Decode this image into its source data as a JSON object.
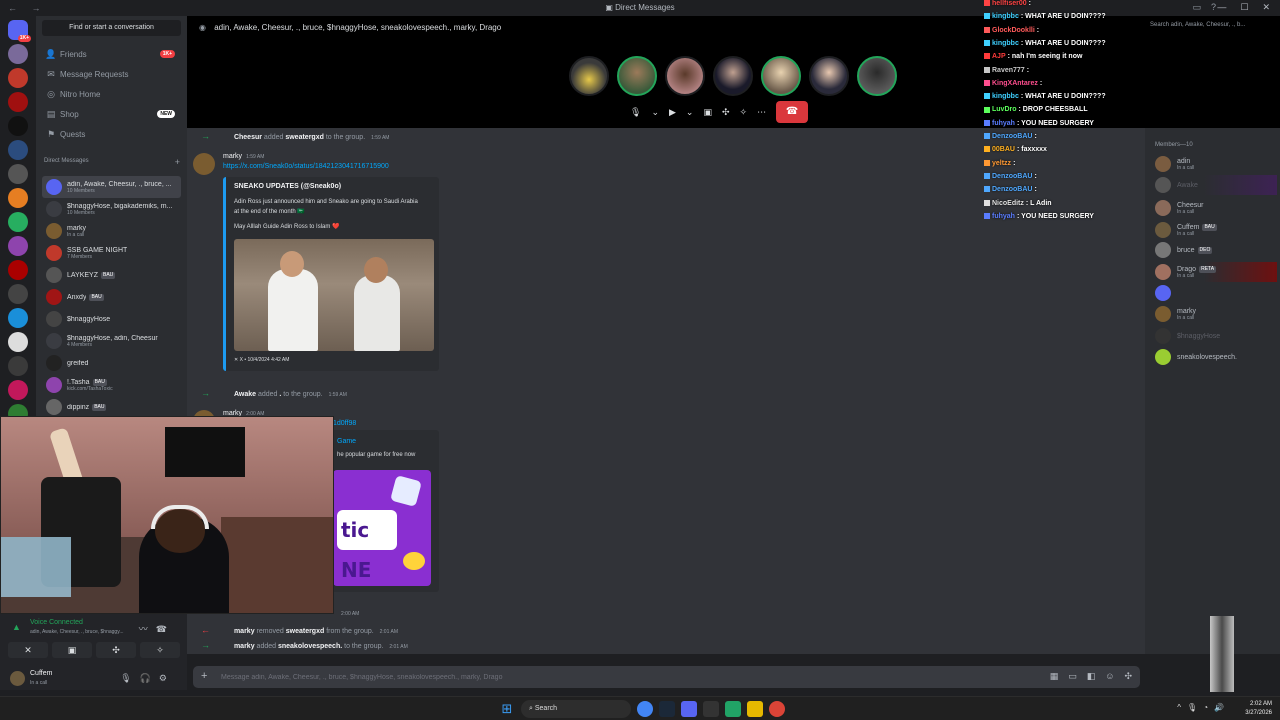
{
  "window": {
    "title": "Direct Messages"
  },
  "sidebar": {
    "find_label": "Find or start a conversation",
    "nav": [
      {
        "label": "Friends",
        "badge": "1K+"
      },
      {
        "label": "Message Requests"
      },
      {
        "label": "Nitro Home"
      },
      {
        "label": "Shop",
        "badge": "NEW"
      },
      {
        "label": "Quests"
      }
    ],
    "dm_header": "Direct Messages",
    "dms": [
      {
        "name": "adin, Awake, Cheesur, ., bruce, ...",
        "sub": "10 Members",
        "color": "#5865f2"
      },
      {
        "name": "$hnaggyHose, bigakademiks, m...",
        "sub": "10 Members",
        "color": "#3a3c42"
      },
      {
        "name": "marky",
        "sub": "In a call",
        "color": "#7a5c30"
      },
      {
        "name": "SSB GAME NIGHT",
        "sub": "7 Members",
        "color": "#c0392b"
      },
      {
        "name": "LAYKEYZ",
        "sub": "",
        "tag": "BAU",
        "color": "#555"
      },
      {
        "name": "Anxdy",
        "sub": "",
        "tag": "BAU",
        "color": "#a01515"
      },
      {
        "name": "$hnaggyHose",
        "sub": "",
        "color": "#444"
      },
      {
        "name": "$hnaggyHose, adin, Cheesur",
        "sub": "4 Members",
        "color": "#3a3c42"
      },
      {
        "name": "greifed",
        "sub": "",
        "color": "#222"
      },
      {
        "name": "!.Tasha",
        "sub": "kick.com/TashaToxic",
        "tag": "BAU",
        "color": "#8e44ad"
      },
      {
        "name": "dippinz",
        "sub": "",
        "tag": "BAU",
        "color": "#666"
      }
    ]
  },
  "voice": {
    "status": "Voice Connected",
    "channel": "adin, Awake, Cheesur, ., bruce, $hnaggy..."
  },
  "user": {
    "name": "Cuffem",
    "status": "In a call"
  },
  "call": {
    "header": "adin, Awake, Cheesur, ., bruce, $hnaggyHose, sneakolovespeech., marky, Drago"
  },
  "messages": {
    "sys1": {
      "user": "Cheesur",
      "action": "added",
      "target": "sweatergxd",
      "rest": "to the group.",
      "time": "1:59 AM"
    },
    "post1": {
      "author": "marky",
      "time": "1:59 AM",
      "link": "https://x.com/Sneak0o/status/1842123041716715900",
      "embed_author": "SNEAKO UPDATES (@Sneak0o)",
      "embed_text": "Adin Ross just announced him and Sneako are going to Saudi Arabia at the end of the month 🇸🇦",
      "embed_text2": "May Alllah Guide Adin Ross to Islam ❤️",
      "embed_footer": "X • 10/4/2024 4:42 AM"
    },
    "sys2": {
      "user": "Awake",
      "action": "added",
      "target": ".",
      "rest": "to the group.",
      "time": "1:59 AM"
    },
    "post2": {
      "author": "marky",
      "time": "2:00 AM",
      "link": "1d0ff98",
      "embed_title": "Game",
      "embed_desc": "he popular game for free now",
      "game_word": "tic NE"
    },
    "sys3": {
      "time": "2:00 AM"
    },
    "sys4": {
      "user": "marky",
      "action": "removed",
      "target": "sweatergxd",
      "rest": "from the group.",
      "time": "2:01 AM"
    },
    "sys5": {
      "user": "marky",
      "action": "added",
      "target": "sneakolovespeech.",
      "rest": "to the group.",
      "time": "2:01 AM"
    }
  },
  "composer": {
    "placeholder": "Message adin, Awake, Cheesur, ., bruce, $hnaggyHose, sneakolovespeech., marky, Drago"
  },
  "members": {
    "header": "Members—10",
    "list": [
      {
        "name": "adin",
        "status": "In a call",
        "color": "#7a5c40"
      },
      {
        "name": "Awake",
        "status": "",
        "dim": true,
        "color": "#555",
        "style": "hl"
      },
      {
        "name": "Cheesur",
        "status": "In a call",
        "color": "#8a6a5a"
      },
      {
        "name": "Cuffem",
        "status": "In a call",
        "tag": "BAU",
        "color": "#6b5a3e"
      },
      {
        "name": "bruce",
        "status": "",
        "tag": "DEO",
        "color": "#777"
      },
      {
        "name": "Drago",
        "status": "In a call",
        "tag": "RETA",
        "color": "#a07060",
        "style": "hl2"
      },
      {
        "name": "",
        "status": "",
        "color": "#5865f2"
      },
      {
        "name": "marky",
        "status": "In a call",
        "color": "#7a5c30"
      },
      {
        "name": "$hnaggyHose",
        "status": "",
        "dim": true,
        "color": "#333"
      },
      {
        "name": "sneakolovespeech.",
        "status": "",
        "color": "#9acd32"
      }
    ]
  },
  "search": {
    "placeholder": "Search adin, Awake, Cheesur, ., b..."
  },
  "twitch_chat": [
    {
      "user": "hellfiser00",
      "msg": "",
      "color": "#ff4444"
    },
    {
      "user": "kingbbc",
      "msg": "WHAT ARE U DOIN????",
      "color": "#3fd0ff"
    },
    {
      "user": "GlockDooklli",
      "msg": "",
      "color": "#ff5a5a"
    },
    {
      "user": "kingbbc",
      "msg": "WHAT ARE U DOIN????",
      "color": "#3fd0ff"
    },
    {
      "user": "AJP",
      "msg": "nah I'm seeing it now",
      "color": "#ff3b3b"
    },
    {
      "user": "Raven777",
      "msg": "",
      "color": "#c7c7c7"
    },
    {
      "user": "KingXAntarez",
      "msg": "",
      "color": "#ff4e8e"
    },
    {
      "user": "kingbbc",
      "msg": "WHAT ARE U DOIN????",
      "color": "#3fd0ff"
    },
    {
      "user": "LuvDro",
      "msg": "DROP CHEESBALL",
      "color": "#5cff5c"
    },
    {
      "user": "fuhyah",
      "msg": "YOU NEED SURGERY",
      "color": "#5a7dff"
    },
    {
      "user": "DenzooBAU",
      "msg": "",
      "color": "#4fa8ff"
    },
    {
      "user": "00BAU",
      "msg": "faxxxxx",
      "color": "#ffb020"
    },
    {
      "user": "yeltzz",
      "msg": "",
      "color": "#ff9933"
    },
    {
      "user": "DenzooBAU",
      "msg": "",
      "color": "#4fa8ff"
    },
    {
      "user": "DenzooBAU",
      "msg": "",
      "color": "#4fa8ff"
    },
    {
      "user": "NicoEditz",
      "msg": "L Adin",
      "color": "#e0e0e0"
    },
    {
      "user": "fuhyah",
      "msg": "YOU NEED SURGERY",
      "color": "#5a7dff"
    }
  ],
  "taskbar": {
    "search": "Search",
    "time": "2:02 AM",
    "date": "3/27/2026"
  }
}
